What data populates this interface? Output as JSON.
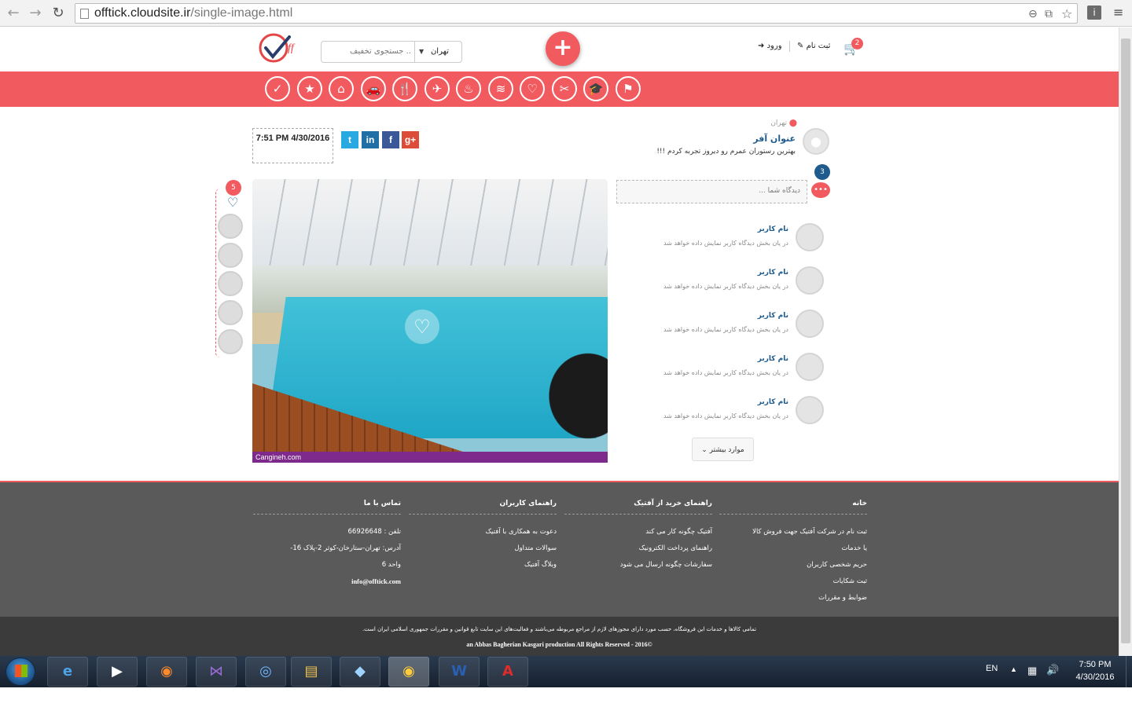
{
  "browser": {
    "url_host": "offtick.cloudsite.ir",
    "url_path": "/single-image.html"
  },
  "header": {
    "search_placeholder": "جستجوی تخفیف ..",
    "city": "تهران",
    "register": "ثبت نام",
    "login": "ورود",
    "cart_count": "2"
  },
  "post": {
    "location": "تهران",
    "title": "عنوان آفر",
    "text": "بهترین رستوران عمرم رو دیروز تجربه کردم !!!",
    "datetime": "7:51 PM 4/30/2016",
    "likes": "5",
    "comment_count": "3",
    "image_watermark": "Cangineh.com",
    "comment_placeholder": "دیدگاه شما ...",
    "more_label": "موارد بیشتر",
    "comments": [
      {
        "name": "نام کاربر",
        "text": "در یان بخش دیدگاه کاربر نمایش داده خواهد شد"
      },
      {
        "name": "نام کاربر",
        "text": "در یان بخش دیدگاه کاربر نمایش داده خواهد شد"
      },
      {
        "name": "نام کاربر",
        "text": "در یان بخش دیدگاه کاربر نمایش داده خواهد شد"
      },
      {
        "name": "نام کاربر",
        "text": "در یان بخش دیدگاه کاربر نمایش داده خواهد شد"
      },
      {
        "name": "نام کاربر",
        "text": "در یان بخش دیدگاه کاربر نمایش داده خواهد شد"
      }
    ]
  },
  "footer": {
    "col1": {
      "title": "خانه",
      "links": [
        "ثبت نام در شرکت آفتیک جهت فروش کالا",
        "یا خدمات",
        "حریم شخصی کاربران",
        "ثبت شکایات",
        "ضوابط و مقررات"
      ]
    },
    "col2": {
      "title": "راهنمای خرید از آفتیک",
      "links": [
        "آفتیک چگونه کار می کند",
        "راهنمای پرداخت الکترونیک",
        "سفارشات چگونه ارسال می شود"
      ]
    },
    "col3": {
      "title": "راهنمای کاربران",
      "links": [
        "دعوت به همکاری با آفتیک",
        "سوالات متداول",
        "وبلاگ آفتیک"
      ]
    },
    "col4": {
      "title": "تماس با ما",
      "links": [
        "تلفن : 66926648",
        "آدرس: تهران-ستارخان-کوثر 2-پلاک 16-",
        "واحد 6",
        "info@offtick.com"
      ]
    },
    "legal": "تمامی کالاها و خدمات این فروشگاه، حسب مورد دارای مجوزهای لازم از مراجع مربوطه می‌باشند و فعالیت‌های این سایت تابع قوانین و مقررات جمهوری اسلامی ایران است.",
    "credit": "an Abbas Bagherian Kasgari production All Rights Reserved - 2016©"
  },
  "taskbar": {
    "lang": "EN",
    "time": "7:50 PM",
    "date": "4/30/2016"
  },
  "colors": {
    "accent": "#f15a5e",
    "brand_blue": "#1f5b8c",
    "footer": "#5a5a5a"
  }
}
